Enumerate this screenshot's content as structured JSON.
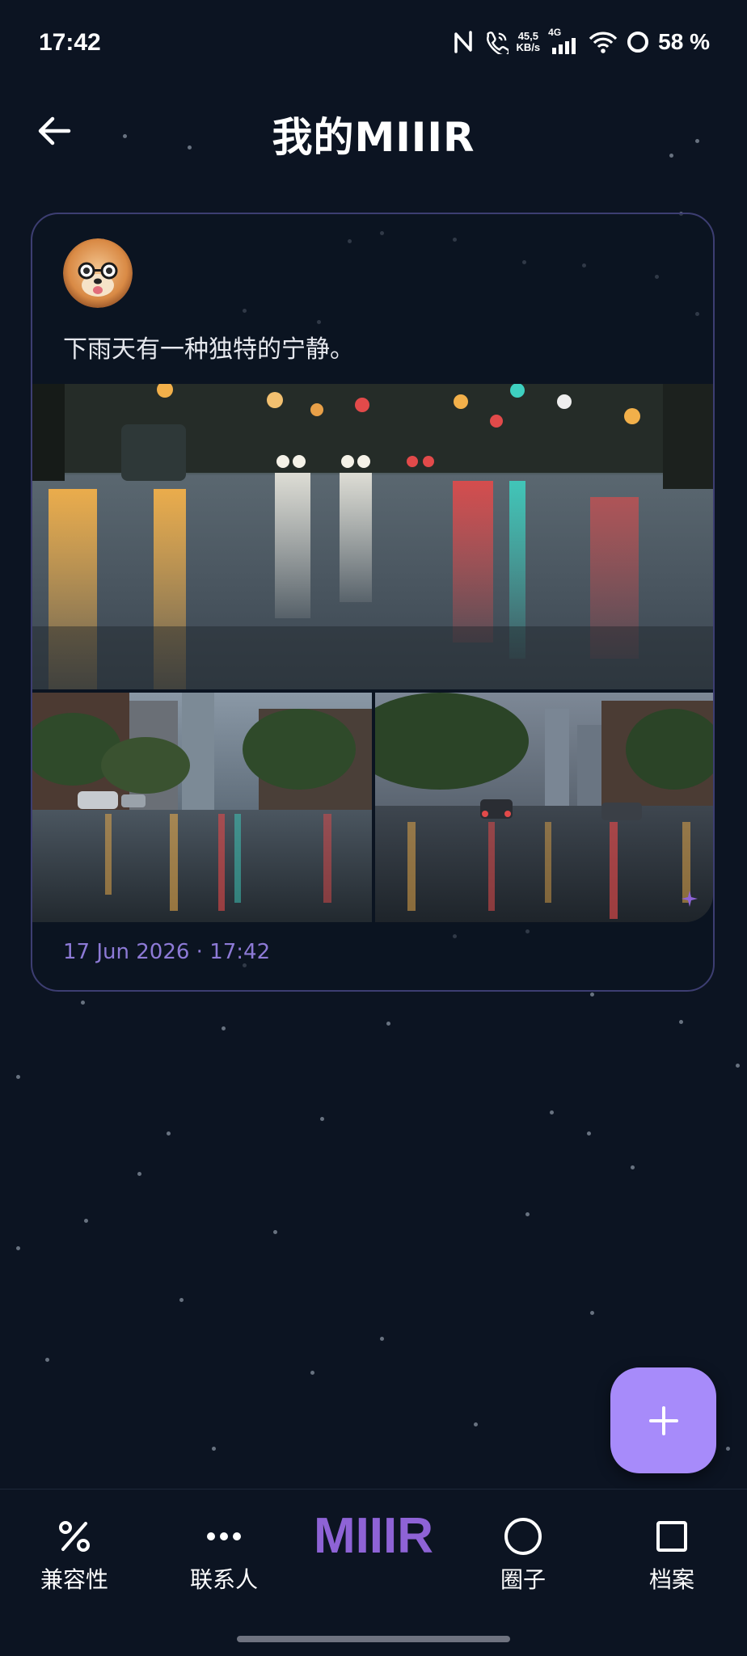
{
  "status_bar": {
    "time": "17:42",
    "net_speed_value": "45,5",
    "net_speed_unit": "KB/s",
    "network_type": "4G",
    "battery": "58 %"
  },
  "header": {
    "title": "我的MIIIR"
  },
  "post": {
    "text": "下雨天有一种独特的宁静。",
    "timestamp": "17 Jun 2026 · 17:42"
  },
  "fab": {
    "icon": "plus-icon",
    "color": "#a78bfa"
  },
  "bottom_nav": {
    "items": [
      {
        "label": "兼容性",
        "icon": "percent-icon"
      },
      {
        "label": "联系人",
        "icon": "more-dots-icon"
      },
      {
        "label": "MIIIR",
        "icon": "logo"
      },
      {
        "label": "圈子",
        "icon": "circle-icon"
      },
      {
        "label": "档案",
        "icon": "square-icon"
      }
    ]
  },
  "colors": {
    "background": "#0c1422",
    "accent": "#a78bfa",
    "logo": "#8e63d6",
    "timestamp": "#8d7ad6",
    "card_border": "#3d3e72"
  }
}
